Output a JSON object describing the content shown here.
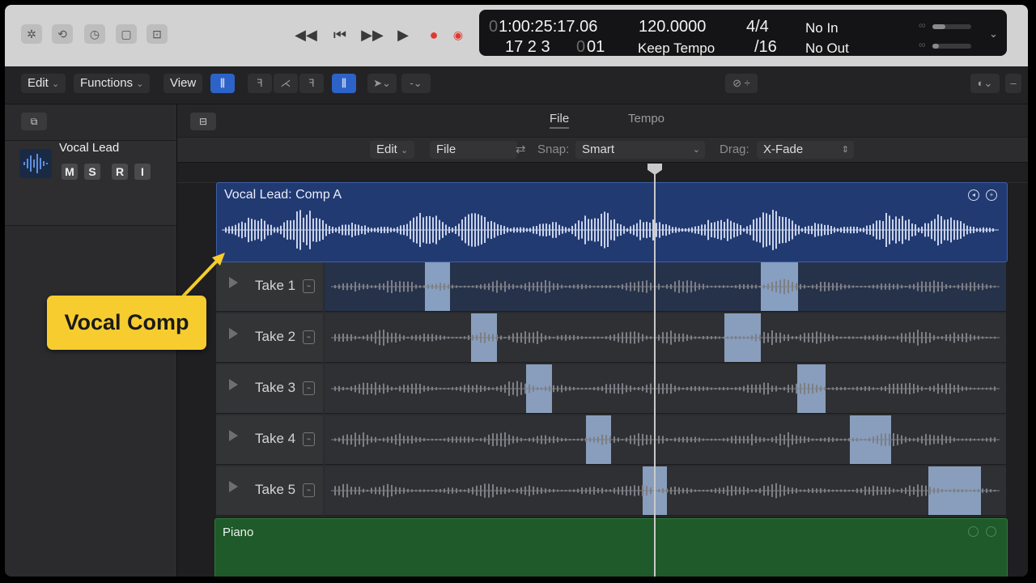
{
  "control_bar": {
    "icons": [
      "library-icon",
      "tempo-sync-icon",
      "metronome-settings-icon",
      "editor-toggle-icon",
      "window-icon"
    ],
    "transport": [
      "rewind",
      "go-to-start",
      "fast-forward",
      "play",
      "record",
      "capture-record"
    ],
    "lcd": {
      "smpte_lead": "0",
      "smpte": "1:00:25:17.06",
      "bars_beats": "17  2  3",
      "ticks_dim": "0",
      "ticks": "01",
      "tempo": "120.0000",
      "tempo_mode": "Keep Tempo",
      "signature": "4/4",
      "division": "/16",
      "midi_in": "No In",
      "midi_out": "No Out"
    }
  },
  "toolbar": {
    "edit_menu": "Edit",
    "functions_menu": "Functions",
    "view_menu": "View"
  },
  "inspector": {
    "track_name": "Vocal Lead",
    "buttons": [
      "M",
      "S",
      "R",
      "I"
    ]
  },
  "tabs": [
    "File",
    "Tempo"
  ],
  "edit_row": {
    "edit": "Edit",
    "file": "File",
    "snap_label": "Snap:",
    "snap_value": "Smart",
    "drag_label": "Drag:",
    "drag_value": "X-Fade"
  },
  "comp_region": {
    "title": "Vocal Lead: Comp A"
  },
  "takes": [
    {
      "label": "Take 1"
    },
    {
      "label": "Take 2"
    },
    {
      "label": "Take 3"
    },
    {
      "label": "Take 4"
    },
    {
      "label": "Take 5"
    }
  ],
  "piano_region": {
    "title": "Piano"
  },
  "callout": {
    "text": "Vocal Comp",
    "color": "#f7cc2f"
  },
  "colors": {
    "comp_region": "#223a72",
    "piano_region": "#1f5a2a",
    "selection": "#9db7da",
    "accent": "#2d63c8"
  }
}
